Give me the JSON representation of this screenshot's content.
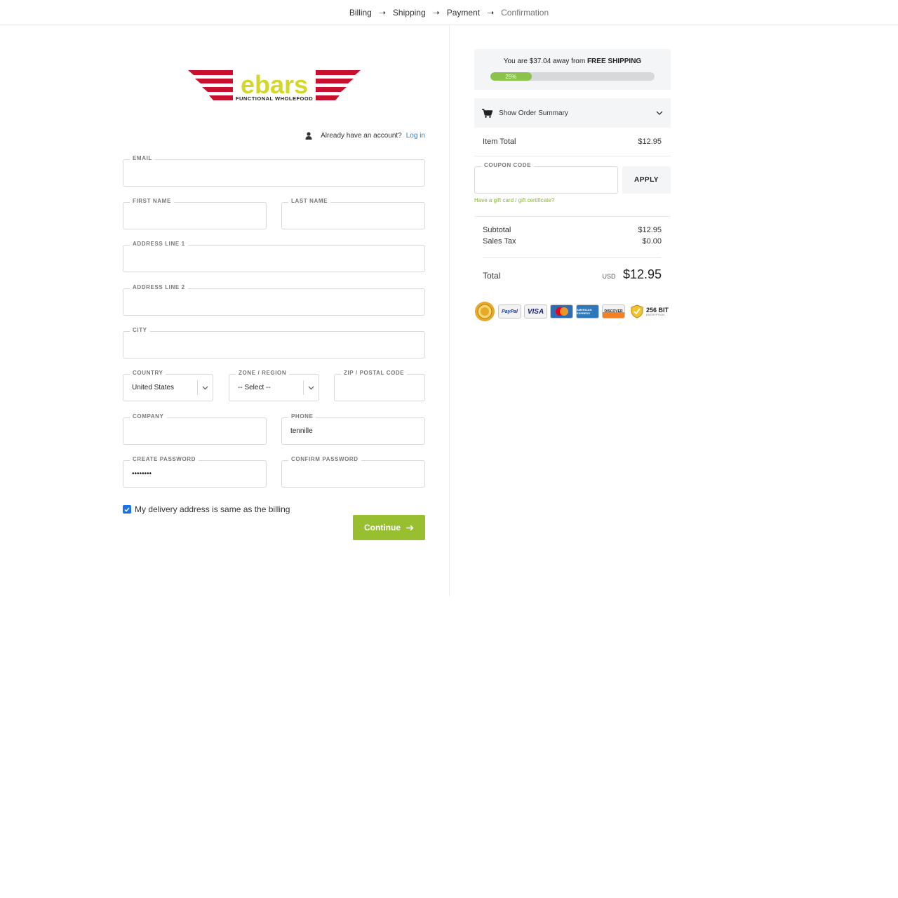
{
  "breadcrumb": {
    "steps": [
      "Billing",
      "Shipping",
      "Payment",
      "Confirmation"
    ]
  },
  "brand": {
    "logo_word": "ebars",
    "logo_tagline": "FUNCTIONAL WHOLEFOOD",
    "colors": {
      "red": "#c8102e",
      "lime": "#d4d62a",
      "accent": "#97bf30",
      "link": "#2f7bd5"
    }
  },
  "account": {
    "prompt": "Already have an account?",
    "login_link": "Log in",
    "icon": "user-icon"
  },
  "form": {
    "email": {
      "label": "EMAIL",
      "value": ""
    },
    "first_name": {
      "label": "FIRST NAME",
      "value": ""
    },
    "last_name": {
      "label": "LAST NAME",
      "value": ""
    },
    "address1": {
      "label": "ADDRESS LINE 1",
      "value": ""
    },
    "address2": {
      "label": "ADDRESS LINE 2",
      "value": ""
    },
    "city": {
      "label": "CITY",
      "value": ""
    },
    "country": {
      "label": "COUNTRY",
      "value": "United States"
    },
    "zone": {
      "label": "ZONE / REGION",
      "value": "-- Select --"
    },
    "zip": {
      "label": "ZIP / POSTAL CODE",
      "value": ""
    },
    "company": {
      "label": "COMPANY",
      "value": ""
    },
    "phone": {
      "label": "PHONE",
      "value": "tennille"
    },
    "password": {
      "label": "CREATE PASSWORD",
      "value": "••••••••"
    },
    "confirm_password": {
      "label": "CONFIRM PASSWORD",
      "value": ""
    },
    "same_address": {
      "label": "My delivery address is same as the billing",
      "checked": true
    },
    "continue_label": "Continue"
  },
  "cart": {
    "shipping_msg_prefix": "You are $37.04 away from",
    "shipping_msg_bold": "FREE SHIPPING",
    "progress_label": "25%",
    "progress_fraction": 0.25,
    "summary_toggle": "Show Order Summary",
    "item_total_label": "Item Total",
    "item_total": "$12.95",
    "coupon_label": "COUPON CODE",
    "apply_label": "APPLY",
    "gift_card_link": "Have a gift card / gift certificate?",
    "subtotal_label": "Subtotal",
    "subtotal": "$12.95",
    "tax_label": "Sales Tax",
    "tax": "$0.00",
    "total_label": "Total",
    "currency": "USD",
    "total": "$12.95"
  },
  "trust": {
    "badges": [
      "PayPal",
      "VISA",
      "MasterCard",
      "AMERICAN EXPRESS",
      "DISCOVER"
    ],
    "encryption_label": "256 BIT",
    "encryption_sub": "ENCRYPTION"
  }
}
